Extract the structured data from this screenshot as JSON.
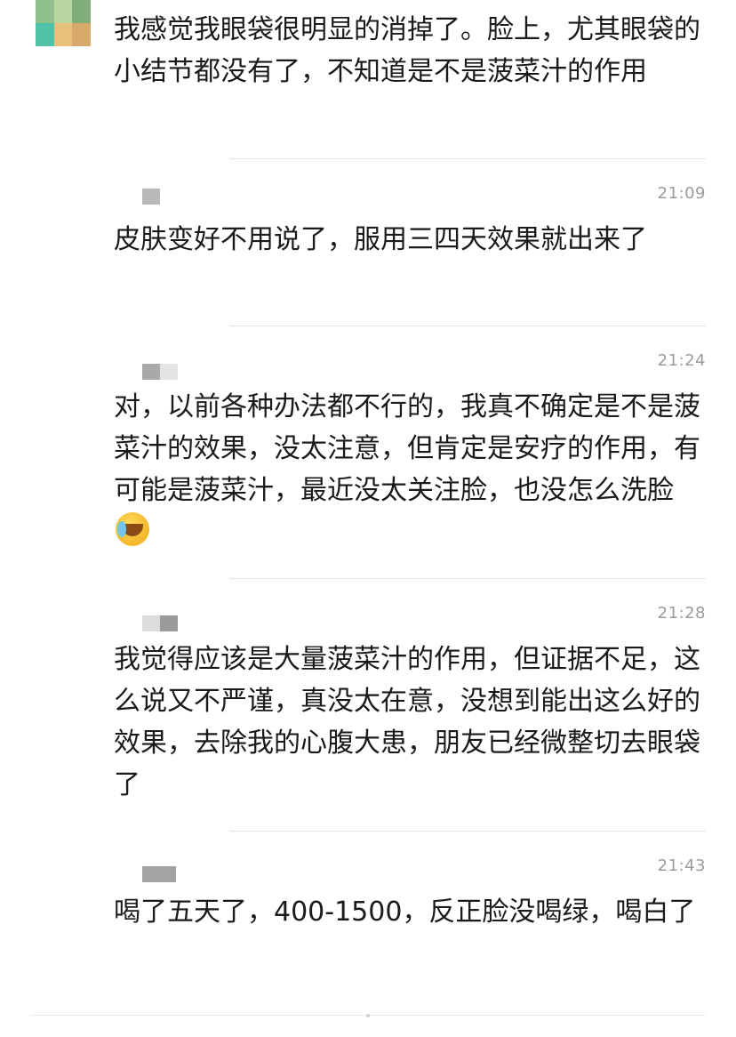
{
  "messages": [
    {
      "time": "",
      "text": "我感觉我眼袋很明显的消掉了。脸上，尤其眼袋的小结节都没有了，不知道是不是菠菜汁的作用"
    },
    {
      "time": "21:09",
      "text": "皮肤变好不用说了，服用三四天效果就出来了"
    },
    {
      "time": "21:24",
      "text": "对，以前各种办法都不行的，我真不确定是不是菠菜汁的效果，没太注意，但肯定是安疗的作用，有可能是菠菜汁，最近没太关注脸，也没怎么洗脸"
    },
    {
      "time": "21:28",
      "text": "我觉得应该是大量菠菜汁的作用，但证据不足，这么说又不严谨，真没太在意，没想到能出这么好的效果，去除我的心腹大患，朋友已经微整切去眼袋了"
    },
    {
      "time": "21:43",
      "text": "喝了五天了，400-1500，反正脸没喝绿，喝白了"
    }
  ],
  "icons": {
    "avatar": "pixelated-avatar",
    "emoji": "crying-laughing-emoji"
  }
}
